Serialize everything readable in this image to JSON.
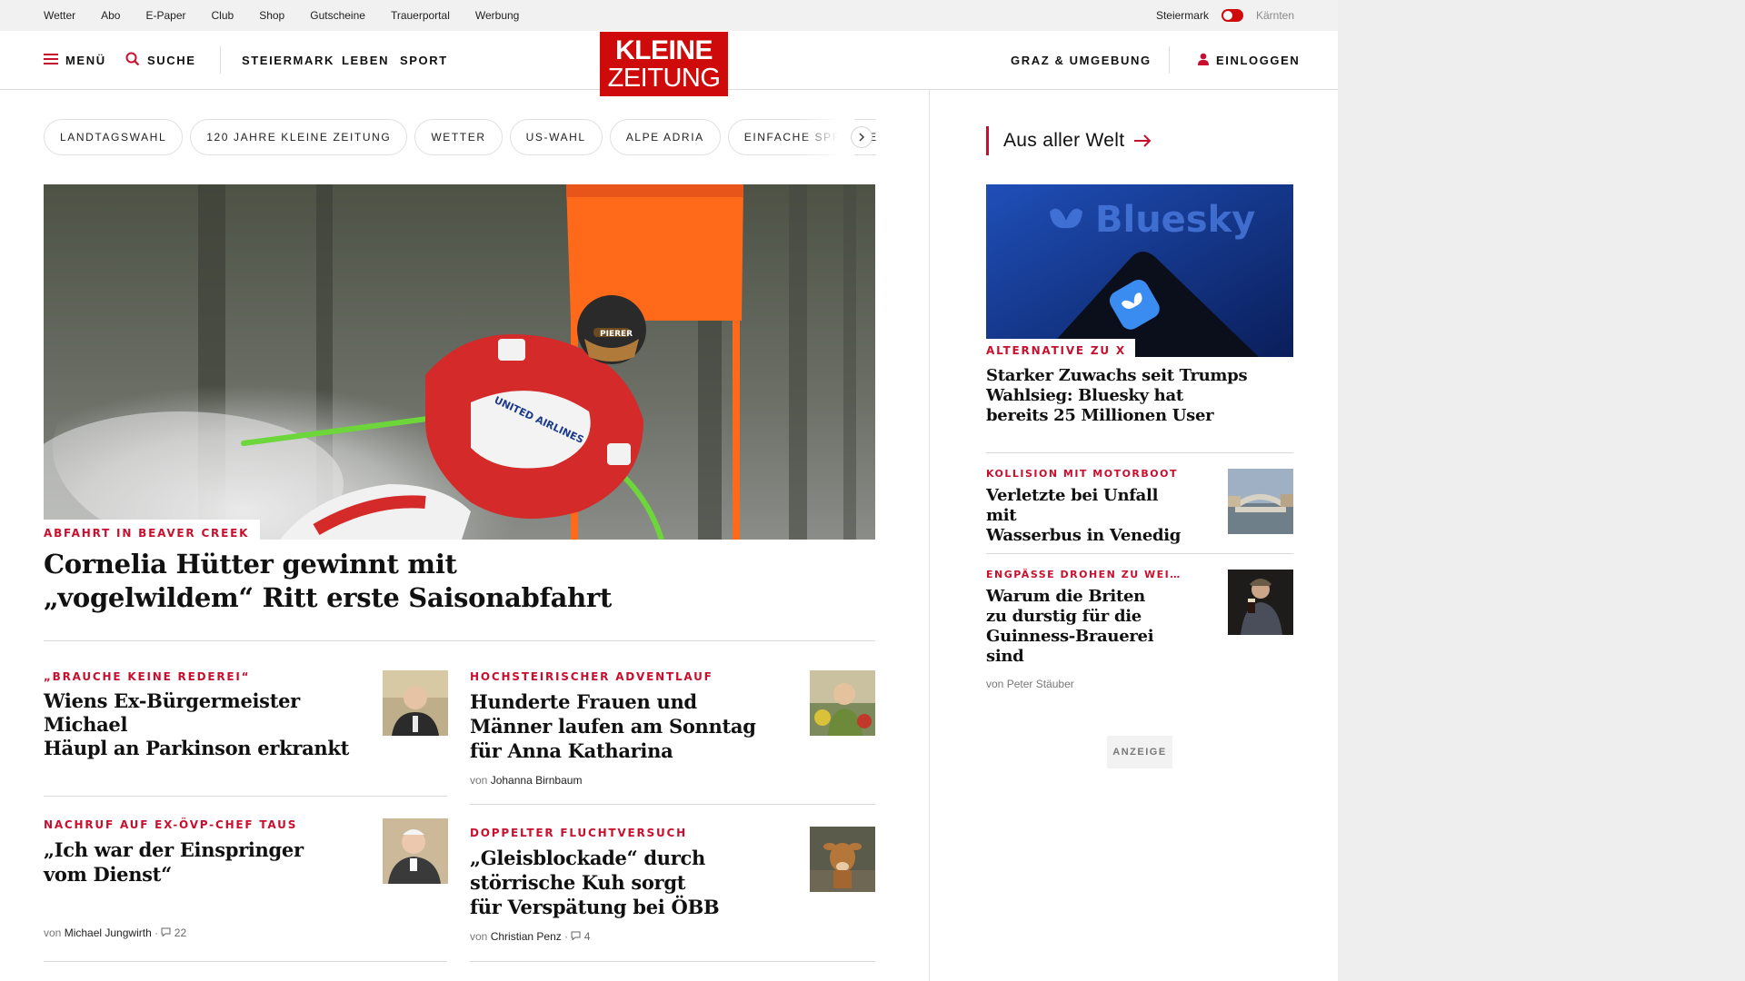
{
  "utility_nav": {
    "links": [
      "Wetter",
      "Abo",
      "E-Paper",
      "Club",
      "Shop",
      "Gutscheine",
      "Trauerportal",
      "Werbung"
    ],
    "region_active": "Steiermark",
    "region_other": "Kärnten"
  },
  "header": {
    "menu_label": "MENÜ",
    "search_label": "SUCHE",
    "nav": [
      "STEIERMARK",
      "LEBEN",
      "SPORT"
    ],
    "logo_line1": "KLEINE",
    "logo_line2": "ZEITUNG",
    "local_label": "GRAZ & UMGEBUNG",
    "login_label": "EINLOGGEN"
  },
  "topics": [
    "LANDTAGSWAHL",
    "120 JAHRE KLEINE ZEITUNG",
    "WETTER",
    "US-WAHL",
    "ALPE ADRIA",
    "EINFACHE SPRACHE"
  ],
  "hero": {
    "kicker": "ABFAHRT IN BEAVER CREEK",
    "title_line1": "Cornelia Hütter gewinnt mit",
    "title_line2": "„vogelwildem“ Ritt erste Saisonabfahrt",
    "bib_sponsor": "UNITED AIRLINES",
    "helmet_sponsor": "PIERER"
  },
  "articles": [
    {
      "kicker": "„BRAUCHE KEINE REDEREI“",
      "title": [
        "Wiens Ex-Bürgermeister Michael",
        "Häupl an Parkinson erkrankt"
      ]
    },
    {
      "kicker": "HOCHSTEIRISCHER ADVENTLAUF",
      "title": [
        "Hunderte Frauen und",
        "Männer laufen am Sonntag",
        "für Anna Katharina"
      ],
      "by": "von",
      "author": "Johanna Birnbaum"
    },
    {
      "kicker": "NACHRUF AUF EX-ÖVP-CHEF TAUS",
      "title": [
        "„Ich war der Einspringer",
        "vom Dienst“"
      ],
      "by": "von",
      "author": "Michael Jungwirth",
      "comments": "22"
    },
    {
      "kicker": "DOPPELTER FLUCHTVERSUCH",
      "title": [
        "„Gleisblockade“ durch",
        "störrische Kuh sorgt",
        "für Verspätung bei ÖBB"
      ],
      "by": "von",
      "author": "Christian Penz",
      "comments": "4"
    }
  ],
  "aside": {
    "section_title": "Aus aller Welt",
    "lead": {
      "kicker": "ALTERNATIVE ZU X",
      "image_text": "Bluesky",
      "title": [
        "Starker Zuwachs seit Trumps",
        "Wahlsieg: Bluesky hat",
        "bereits 25 Millionen User"
      ]
    },
    "items": [
      {
        "kicker": "KOLLISION MIT MOTORBOOT",
        "title": [
          "Verletzte bei Unfall mit",
          "Wasserbus in Venedig"
        ]
      },
      {
        "kicker": "ENGPÄSSE DROHEN ZU WEI…",
        "title": [
          "Warum die Briten",
          "zu durstig für die",
          "Guinness-Brauerei sind"
        ],
        "by": "von",
        "author": "Peter Stäuber"
      }
    ],
    "ad_label": "ANZEIGE"
  },
  "colors": {
    "accent": "#cf0a0a",
    "kicker": "#c8102e"
  }
}
